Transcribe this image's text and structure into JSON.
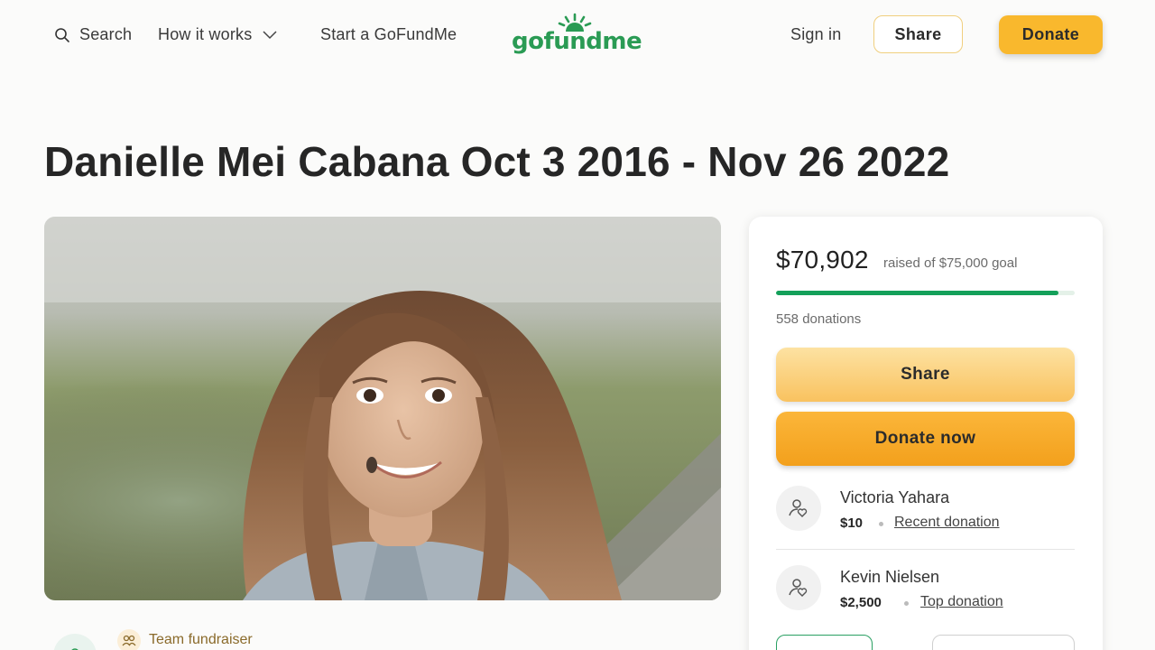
{
  "nav": {
    "search_label": "Search",
    "how_label": "How it works",
    "start_label": "Start a GoFundMe",
    "logo_text": "gofundme",
    "signin_label": "Sign in",
    "share_label": "Share",
    "donate_label": "Donate"
  },
  "campaign": {
    "title": "Danielle Mei Cabana Oct 3 2016 - Nov 26 2022",
    "team_label": "Team fundraiser"
  },
  "donation_card": {
    "raised_amount": "$70,902",
    "raised_of": "raised of $75,000 goal",
    "progress_fraction": 0.945,
    "donations_count": "558 donations",
    "share_label": "Share",
    "donate_now_label": "Donate now",
    "donors": [
      {
        "name": "Victoria Yahara",
        "amount": "$10",
        "type": "Recent donation"
      },
      {
        "name": "Kevin Nielsen",
        "amount": "$2,500",
        "type": "Top donation"
      }
    ]
  },
  "colors": {
    "brand_green": "#2a9b54",
    "donate_orange": "#f9b82d",
    "progress_green": "#14a05a"
  }
}
